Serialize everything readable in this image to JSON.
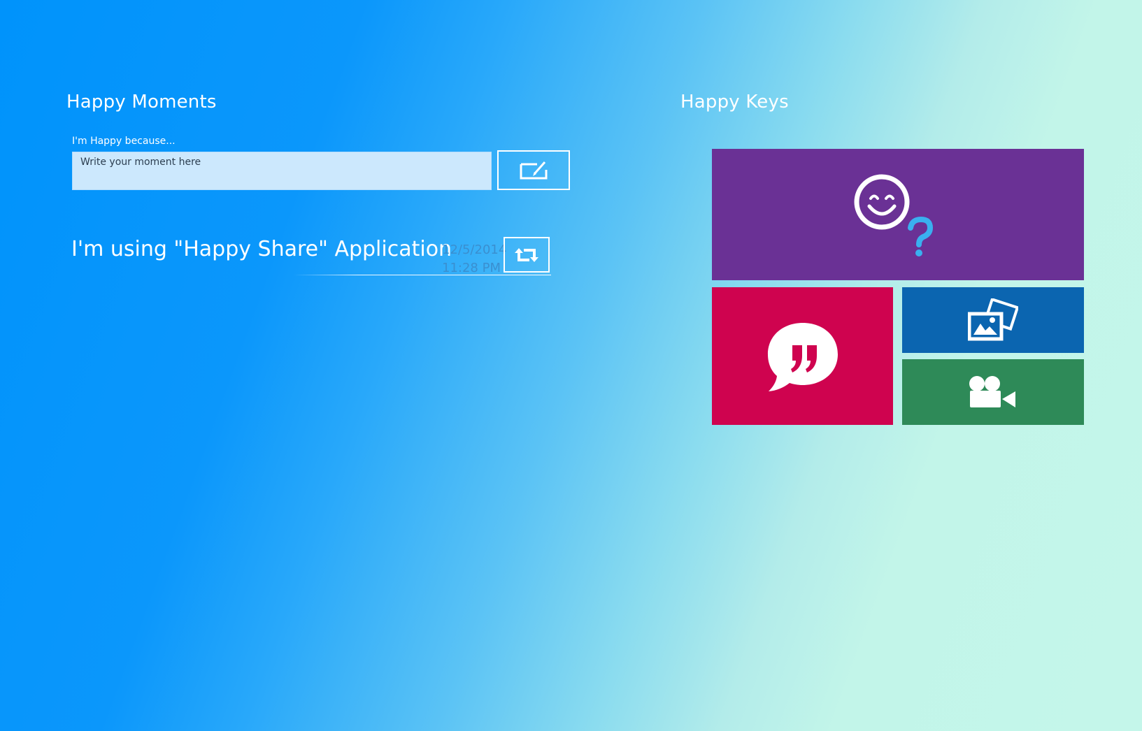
{
  "moments": {
    "title": "Happy Moments",
    "input_label": "I'm Happy because...",
    "input_placeholder": "Write your moment here",
    "post_button_icon": "compose-icon"
  },
  "feed": {
    "items": [
      {
        "text": "I'm using \"Happy Share\" Application",
        "date": "12/5/2014",
        "time": "11:28 PM",
        "reshare_icon": "retweet-icon"
      }
    ]
  },
  "keys": {
    "title": "Happy Keys",
    "tiles": [
      {
        "icon": "smiley-question-icon",
        "color": "#6a3195",
        "accent": "#3ab0ef"
      },
      {
        "icon": "quote-bubble-icon",
        "color": "#cf034f"
      },
      {
        "icon": "photo-icon",
        "color": "#0b65b0"
      },
      {
        "icon": "video-camera-icon",
        "color": "#2e8a58"
      }
    ]
  },
  "colors": {
    "background_start": "#0093fb",
    "background_end": "#c4f6ea",
    "input_background": "#cce8fd",
    "date_text": "#3a8fd0"
  }
}
